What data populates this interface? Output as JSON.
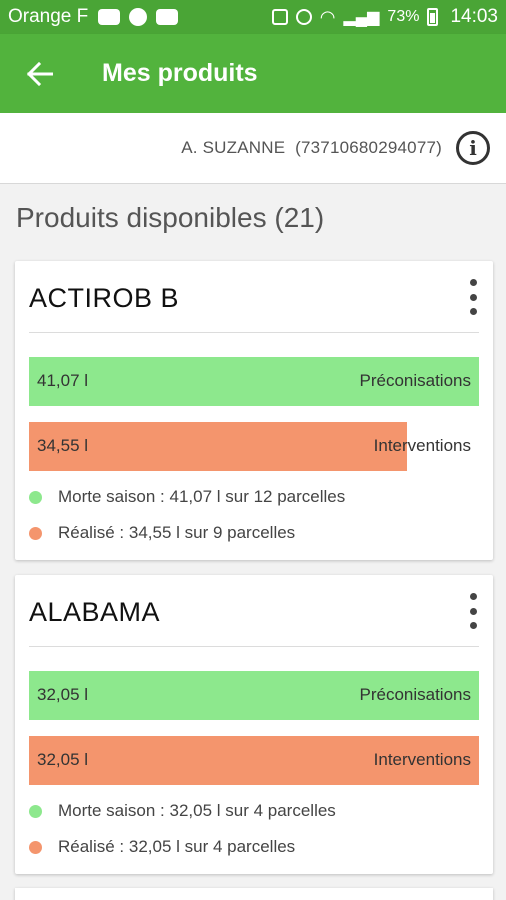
{
  "status_bar": {
    "carrier": "Orange F",
    "battery": "73%",
    "time": "14:03"
  },
  "app_bar": {
    "title": "Mes produits",
    "back_icon": "arrow-back-icon"
  },
  "user": {
    "text": "A. SUZANNE  (73710680294077)",
    "info_icon": "info-icon"
  },
  "section": {
    "title": "Produits disponibles (21)"
  },
  "products": [
    {
      "name": "ACTIROB B",
      "preco_value": "41,07 l",
      "preco_label": "Préconisations",
      "preco_fill": 1.0,
      "interv_value": "34,55 l",
      "interv_label": "Interventions",
      "interv_fill": 0.841,
      "legend_green": "Morte saison : 41,07 l sur 12 parcelles",
      "legend_orange": "Réalisé : 34,55 l sur 9 parcelles"
    },
    {
      "name": "ALABAMA",
      "preco_value": "32,05 l",
      "preco_label": "Préconisations",
      "preco_fill": 1.0,
      "interv_value": "32,05 l",
      "interv_label": "Interventions",
      "interv_fill": 1.0,
      "legend_green": "Morte saison : 32,05 l sur 4 parcelles",
      "legend_orange": "Réalisé : 32,05 l sur 4 parcelles"
    }
  ],
  "colors": {
    "primary": "#52b33d",
    "status_bar": "#4aa536",
    "preco": "#8de88d",
    "interv": "#f4956d"
  }
}
